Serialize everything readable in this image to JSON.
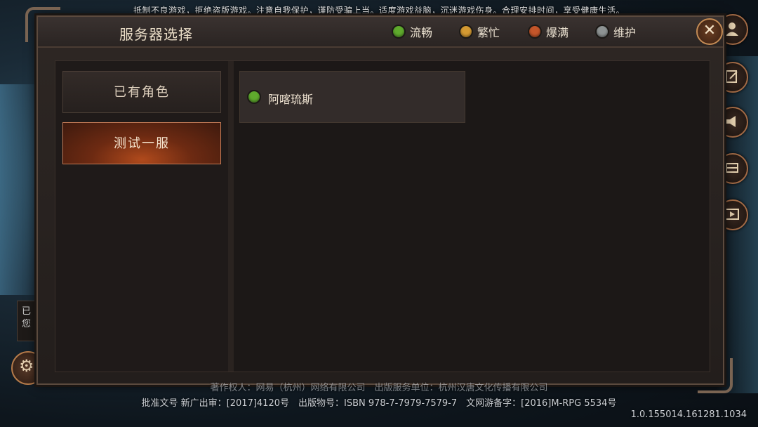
{
  "top_notice": "抵制不良游戏，拒绝盗版游戏。注意自我保护，谨防受骗上当。适度游戏益脑，沉迷游戏伤身。合理安排时间，享受健康生活。",
  "dialog": {
    "title": "服务器选择",
    "close_icon": "close-icon",
    "legend": [
      {
        "label": "流畅",
        "color": "#5faa2d"
      },
      {
        "label": "繁忙",
        "color": "#d49a32"
      },
      {
        "label": "爆满",
        "color": "#c4562a"
      },
      {
        "label": "维护",
        "color": "#8e9393"
      }
    ],
    "categories": [
      {
        "label": "已有角色",
        "active": false
      },
      {
        "label": "测试一服",
        "active": true
      }
    ],
    "servers": [
      {
        "name": "阿喀琉斯",
        "status_color": "#5faa2d"
      }
    ]
  },
  "side_icons": [
    "user-icon",
    "edit-icon",
    "announcement-icon",
    "switch-icon",
    "video-icon"
  ],
  "tooltip_text": "已 您",
  "license": {
    "line1": "著作权人：网易（杭州）网络有限公司　出版服务单位：杭州汉唐文化传播有限公司",
    "line2": "批准文号 新广出审：[2017]4120号　出版物号：ISBN 978-7-7979-7579-7　文网游备字：[2016]M-RPG 5534号"
  },
  "version": "1.0.155014.161281.1034"
}
